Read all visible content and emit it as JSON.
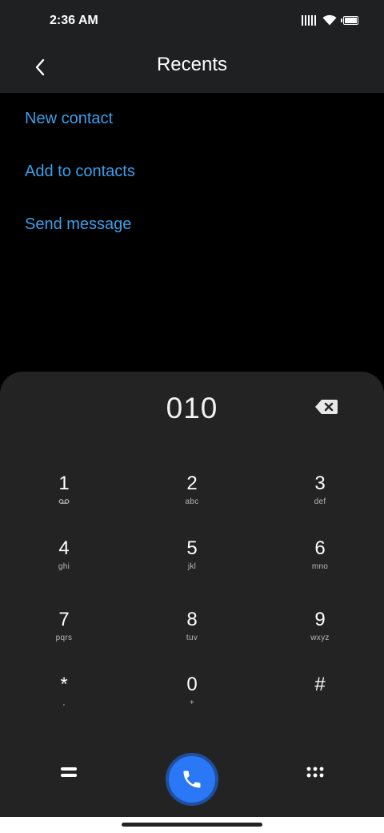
{
  "status_bar": {
    "time": "2:36 AM"
  },
  "app_bar": {
    "title": "Recents"
  },
  "actions": [
    "New contact",
    "Add to contacts",
    "Send message"
  ],
  "dialpad": {
    "number": "010",
    "keys": [
      {
        "digit": "1",
        "letters": ""
      },
      {
        "digit": "2",
        "letters": "abc"
      },
      {
        "digit": "3",
        "letters": "def"
      },
      {
        "digit": "4",
        "letters": "ghi"
      },
      {
        "digit": "5",
        "letters": "jkl"
      },
      {
        "digit": "6",
        "letters": "mno"
      },
      {
        "digit": "7",
        "letters": "pqrs"
      },
      {
        "digit": "8",
        "letters": "tuv"
      },
      {
        "digit": "9",
        "letters": "wxyz"
      },
      {
        "digit": "*",
        "letters": ","
      },
      {
        "digit": "0",
        "letters": "+"
      },
      {
        "digit": "#",
        "letters": ""
      }
    ]
  },
  "colors": {
    "accent": "#3a9fea",
    "call_button": "#2b78f7",
    "dialpad_bg": "#232323",
    "bar_bg": "#1f2022"
  },
  "icons": {
    "back": "chevron-left-icon",
    "backspace": "backspace-icon",
    "voicemail": "voicemail-icon",
    "menu": "equals-menu-icon",
    "call": "phone-icon",
    "dialpad_toggle": "dialpad-grid-icon"
  }
}
